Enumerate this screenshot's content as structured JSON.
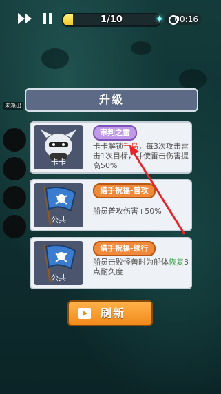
{
  "hud": {
    "progress_text": "1/10",
    "progress_fraction": 0.1,
    "timer": "00:16"
  },
  "side": {
    "label": "未派出"
  },
  "panel": {
    "title": "升级"
  },
  "cards": [
    {
      "icon_name": "卡卡",
      "title": "审判之雷",
      "desc_parts": [
        "卡卡解锁",
        "千鸟",
        "，每3次攻击雷击1次目标，并使雷击伤害提高50%"
      ]
    },
    {
      "icon_name": "公共",
      "title": "猎手祝福-普攻",
      "desc": "船员普攻伤害+50%"
    },
    {
      "icon_name": "公共",
      "title": "猎手祝福-续行",
      "desc_parts": [
        "船员击败怪兽时为船体",
        "恢复",
        "3点耐久度"
      ]
    }
  ],
  "refresh": {
    "label": "刷新"
  },
  "colors": {
    "accent_orange": "#f08a1a",
    "highlight_red": "#e23a2a",
    "highlight_green": "#2c9f3a"
  }
}
